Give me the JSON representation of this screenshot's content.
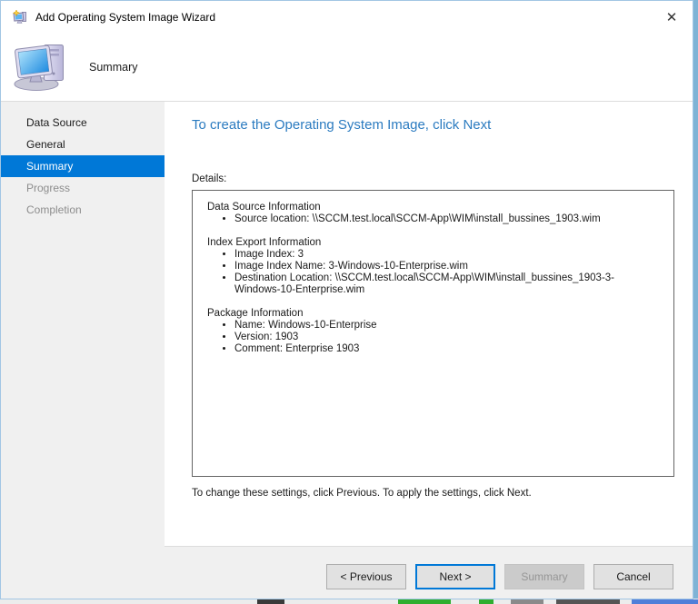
{
  "window": {
    "title": "Add Operating System Image Wizard"
  },
  "icons": {
    "close": "✕",
    "app_icon": "computer-with-sparkle",
    "header_icon": "desktop-computer"
  },
  "header": {
    "page_title": "Summary"
  },
  "sidebar": {
    "items": [
      {
        "label": "Data Source",
        "state": "visited"
      },
      {
        "label": "General",
        "state": "visited"
      },
      {
        "label": "Summary",
        "state": "current"
      },
      {
        "label": "Progress",
        "state": "upcoming"
      },
      {
        "label": "Completion",
        "state": "upcoming"
      }
    ]
  },
  "content": {
    "heading": "To create the Operating System Image, click Next",
    "details_label": "Details:",
    "sections": [
      {
        "title": "Data Source Information",
        "items": [
          "Source location: \\\\SCCM.test.local\\SCCM-App\\WIM\\install_bussines_1903.wim"
        ]
      },
      {
        "title": "Index Export Information",
        "items": [
          "Image Index: 3",
          "Image Index Name: 3-Windows-10-Enterprise.wim",
          "Destination Location: \\\\SCCM.test.local\\SCCM-App\\WIM\\install_bussines_1903-3-Windows-10-Enterprise.wim"
        ]
      },
      {
        "title": "Package Information",
        "items": [
          "Name: Windows-10-Enterprise",
          "Version: 1903",
          "Comment: Enterprise 1903"
        ]
      }
    ],
    "footnote": "To change these settings, click Previous. To apply the settings, click Next."
  },
  "footer": {
    "buttons": [
      {
        "label": "< Previous",
        "state": "normal"
      },
      {
        "label": "Next >",
        "state": "default"
      },
      {
        "label": "Summary",
        "state": "disabled"
      },
      {
        "label": "Cancel",
        "state": "normal"
      }
    ]
  },
  "colors": {
    "accent": "#0078d7",
    "heading_blue": "#2b7bc0",
    "selected_item_bg": "#0078d7",
    "dialog_border": "#a2c6e4",
    "sidebar_bg": "#f0f0f0"
  }
}
